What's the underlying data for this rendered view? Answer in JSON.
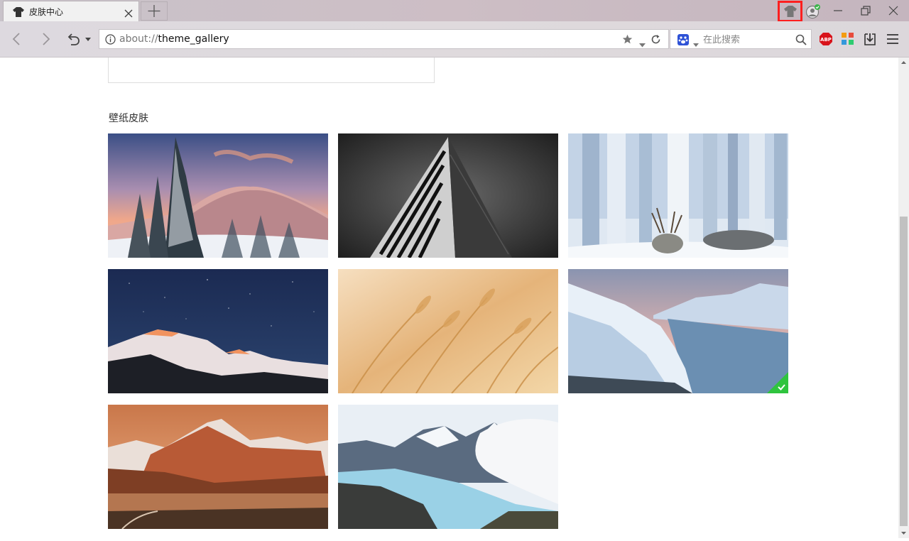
{
  "window": {
    "tab_title": "皮肤中心",
    "skin_button_highlight": "#ff1f1f"
  },
  "navbar": {
    "url_scheme": "about://",
    "url_path": "theme_gallery",
    "search_placeholder": "在此搜索",
    "abp_label": "ABP"
  },
  "content": {
    "section_title": "壁纸皮肤",
    "wallpapers": [
      {
        "subject": "snowy-pines-sunset",
        "selected": false
      },
      {
        "subject": "bw-architecture",
        "selected": false
      },
      {
        "subject": "reindeer-birch-forest",
        "selected": false
      },
      {
        "subject": "starry-mountain-ridge",
        "selected": false
      },
      {
        "subject": "golden-wheat",
        "selected": false
      },
      {
        "subject": "fjord-winter",
        "selected": true
      },
      {
        "subject": "mountain-lake-sunset",
        "selected": false
      },
      {
        "subject": "glacier-clouds",
        "selected": false
      }
    ],
    "selected_color": "#2fc43e"
  }
}
